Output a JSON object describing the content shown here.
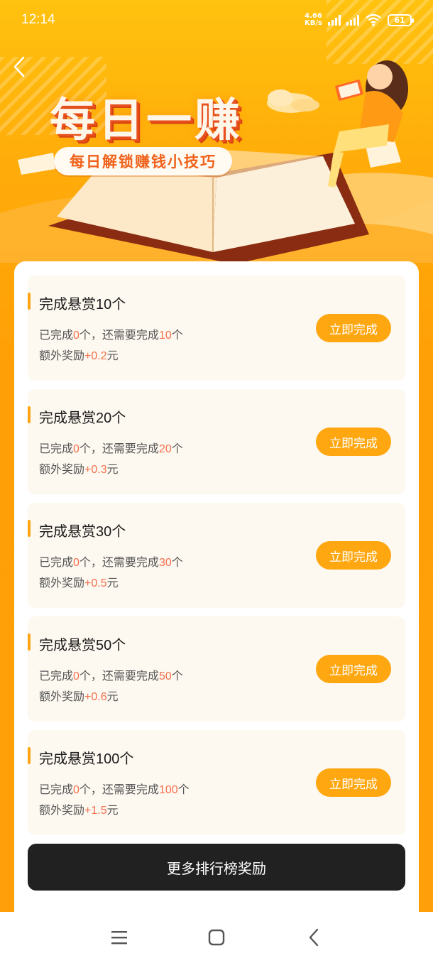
{
  "status_bar": {
    "time": "12:14",
    "net_speed_value": "4.66",
    "net_speed_unit": "KB/s",
    "battery": "61"
  },
  "banner": {
    "title": "每日一赚",
    "subtitle": "每日解锁赚钱小技巧"
  },
  "tasks": [
    {
      "title": "完成悬赏10个",
      "done_prefix": "已完成",
      "done_count": "0",
      "need_mid": "个，还需要完成",
      "need_count": "10",
      "need_suffix": "个",
      "reward_prefix": "额外奖励",
      "reward_value": "+0.2",
      "reward_suffix": "元",
      "button": "立即完成"
    },
    {
      "title": "完成悬赏20个",
      "done_prefix": "已完成",
      "done_count": "0",
      "need_mid": "个，还需要完成",
      "need_count": "20",
      "need_suffix": "个",
      "reward_prefix": "额外奖励",
      "reward_value": "+0.3",
      "reward_suffix": "元",
      "button": "立即完成"
    },
    {
      "title": "完成悬赏30个",
      "done_prefix": "已完成",
      "done_count": "0",
      "need_mid": "个，还需要完成",
      "need_count": "30",
      "need_suffix": "个",
      "reward_prefix": "额外奖励",
      "reward_value": "+0.5",
      "reward_suffix": "元",
      "button": "立即完成"
    },
    {
      "title": "完成悬赏50个",
      "done_prefix": "已完成",
      "done_count": "0",
      "need_mid": "个，还需要完成",
      "need_count": "50",
      "need_suffix": "个",
      "reward_prefix": "额外奖励",
      "reward_value": "+0.6",
      "reward_suffix": "元",
      "button": "立即完成"
    },
    {
      "title": "完成悬赏100个",
      "done_prefix": "已完成",
      "done_count": "0",
      "need_mid": "个，还需要完成",
      "need_count": "100",
      "need_suffix": "个",
      "reward_prefix": "额外奖励",
      "reward_value": "+1.5",
      "reward_suffix": "元",
      "button": "立即完成"
    }
  ],
  "cta": {
    "label": "更多排行榜奖励"
  },
  "colors": {
    "accent": "#ffa710",
    "highlight": "#f6704e",
    "background": "#ffac0a",
    "cta": "#212121"
  },
  "icons": {
    "back": "chevron-left-icon",
    "nav_menu": "menu-icon",
    "nav_home": "square-home-icon",
    "nav_back": "back-triangle-icon"
  }
}
